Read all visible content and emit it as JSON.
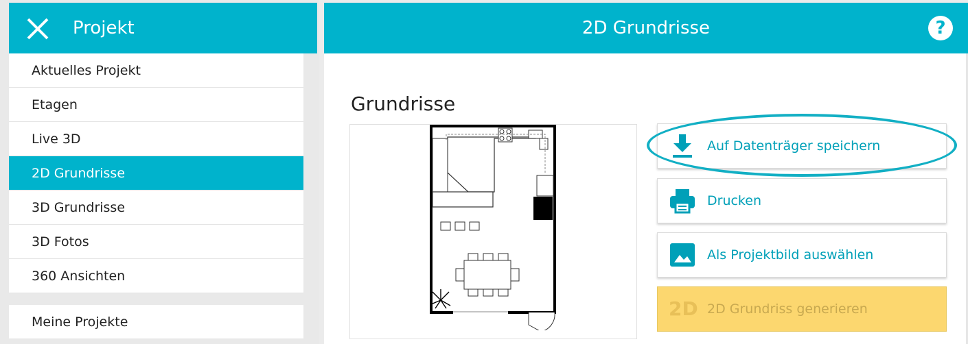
{
  "sidebar": {
    "title": "Projekt",
    "items": [
      {
        "label": "Aktuelles Projekt"
      },
      {
        "label": "Etagen"
      },
      {
        "label": "Live 3D"
      },
      {
        "label": "2D Grundrisse"
      },
      {
        "label": "3D Grundrisse"
      },
      {
        "label": "3D Fotos"
      },
      {
        "label": "360 Ansichten"
      }
    ],
    "footer_item": "Meine Projekte",
    "active_index": 3
  },
  "header": {
    "title": "2D Grundrisse",
    "help_label": "?"
  },
  "main": {
    "section_title": "Grundrisse",
    "actions": [
      {
        "label": "Auf Datenträger speichern",
        "icon": "download-icon"
      },
      {
        "label": "Drucken",
        "icon": "printer-icon"
      },
      {
        "label": "Als Projektbild auswählen",
        "icon": "image-icon"
      },
      {
        "label": "2D Grundriss generieren",
        "icon": "2d-icon",
        "icon_text": "2D",
        "disabled": true
      }
    ]
  },
  "colors": {
    "accent": "#00b3cc",
    "disabled_bg": "#fcd76f"
  }
}
